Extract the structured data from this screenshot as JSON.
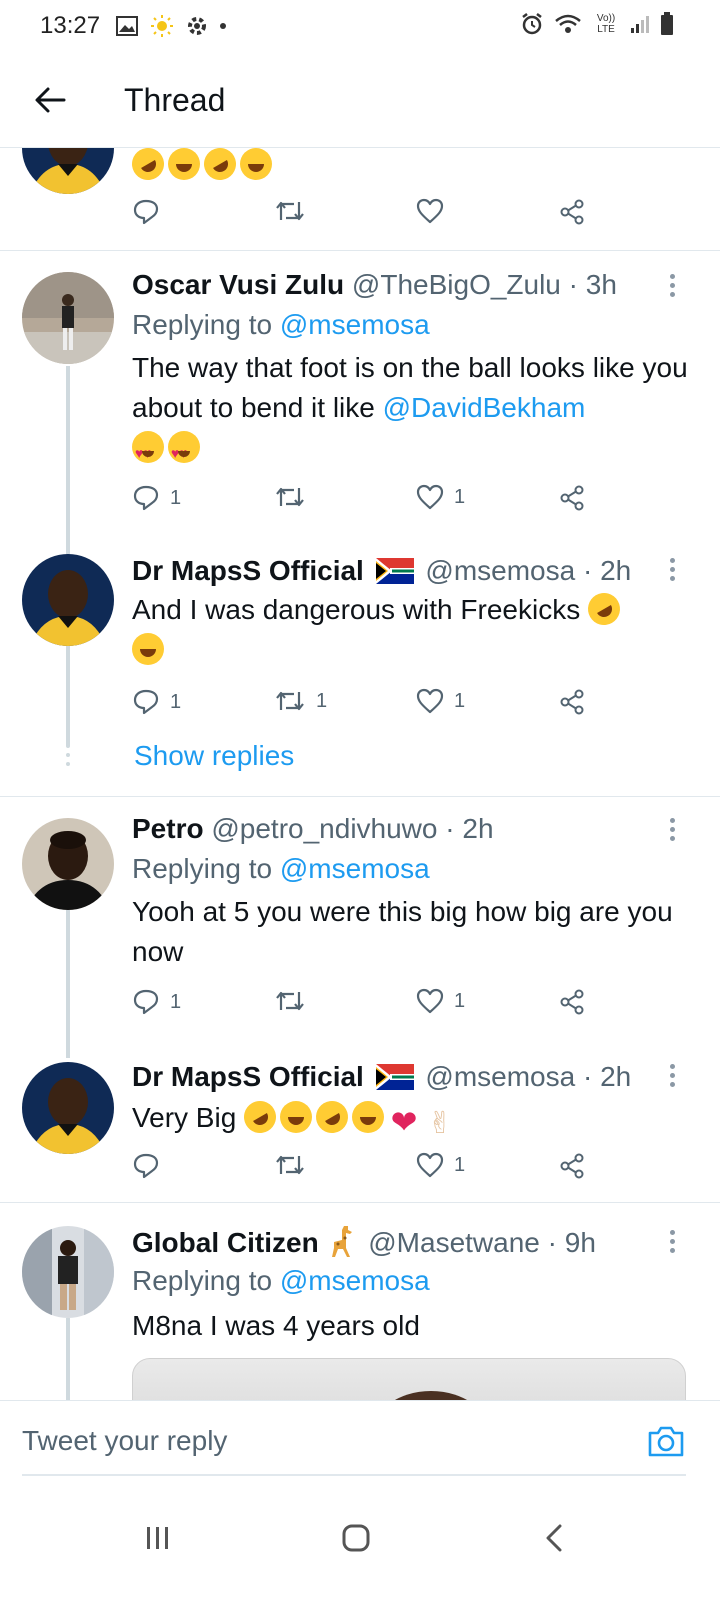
{
  "status_bar": {
    "time": "13:27",
    "network_label": "Vo)) LTE"
  },
  "header": {
    "title": "Thread"
  },
  "top_partial_tweet": {},
  "tweets": [
    {
      "name": "Oscar Vusi Zulu",
      "handle": "@TheBigO_Zulu",
      "time": "3h",
      "replying_prefix": "Replying to",
      "replying_to": "@msemosa",
      "text_a": "The way that foot is on the ball looks like you about to bend it like",
      "text_mention": "@DavidBekham",
      "reply_count": "1",
      "retweet_count": "",
      "like_count": "1"
    },
    {
      "name": "Dr MapsS Official",
      "handle": "@msemosa",
      "time": "2h",
      "text": "And I was dangerous with Freekicks",
      "reply_count": "1",
      "retweet_count": "1",
      "like_count": "1",
      "show_replies": "Show replies"
    },
    {
      "name": "Petro",
      "handle": "@petro_ndivhuwo",
      "time": "2h",
      "replying_prefix": "Replying to",
      "replying_to": "@msemosa",
      "text": "Yooh at 5 you were this big how big are you now",
      "reply_count": "1",
      "retweet_count": "",
      "like_count": "1"
    },
    {
      "name": "Dr MapsS Official",
      "handle": "@msemosa",
      "time": "2h",
      "text": "Very Big",
      "reply_count": "",
      "retweet_count": "",
      "like_count": "1"
    },
    {
      "name": "Global Citizen",
      "handle": "@Masetwane",
      "time": "9h",
      "replying_prefix": "Replying to",
      "replying_to": "@msemosa",
      "text": "M8na I was 4 years old"
    }
  ],
  "reply_bar": {
    "placeholder": "Tweet your reply"
  },
  "colors": {
    "accent": "#1d9bf0",
    "text_primary": "#0f1419",
    "text_secondary": "#536471",
    "divider": "#e1e8ed"
  }
}
